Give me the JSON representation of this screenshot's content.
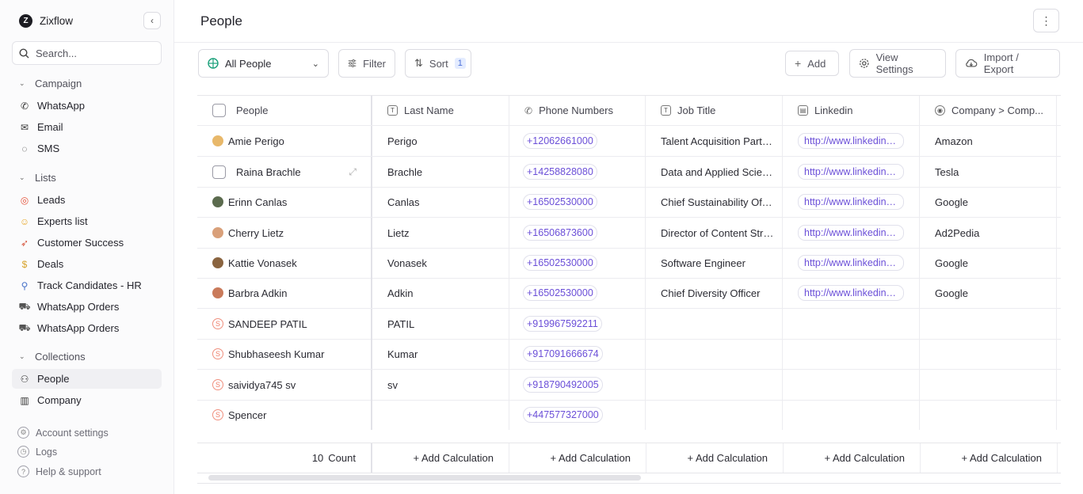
{
  "app": {
    "name": "Zixflow"
  },
  "sidebar": {
    "search_placeholder": "Search...",
    "sections": [
      {
        "title": "Campaign",
        "items": [
          {
            "label": "WhatsApp",
            "icon": "whatsapp-icon"
          },
          {
            "label": "Email",
            "icon": "email-icon"
          },
          {
            "label": "SMS",
            "icon": "sms-icon"
          }
        ]
      },
      {
        "title": "Lists",
        "items": [
          {
            "label": "Leads",
            "icon": "target-emoji-icon"
          },
          {
            "label": "Experts list",
            "icon": "nerd-emoji-icon"
          },
          {
            "label": "Customer Success",
            "icon": "rocket-emoji-icon"
          },
          {
            "label": "Deals",
            "icon": "money-bag-emoji-icon"
          },
          {
            "label": "Track Candidates - HR",
            "icon": "magnifier-emoji-icon"
          },
          {
            "label": "WhatsApp Orders",
            "icon": "cart-emoji-icon"
          },
          {
            "label": "WhatsApp Orders",
            "icon": "cart-emoji-icon"
          }
        ]
      },
      {
        "title": "Collections",
        "items": [
          {
            "label": "People",
            "icon": "people-icon",
            "active": true
          },
          {
            "label": "Company",
            "icon": "building-icon"
          }
        ]
      }
    ],
    "footer": [
      {
        "label": "Account settings",
        "icon": "gear-icon"
      },
      {
        "label": "Logs",
        "icon": "clock-icon"
      },
      {
        "label": "Help & support",
        "icon": "help-icon"
      }
    ]
  },
  "header": {
    "title": "People"
  },
  "toolbar": {
    "view": "All People",
    "filter": "Filter",
    "sort": "Sort",
    "sort_count": "1",
    "add": "Add",
    "view_settings": "View Settings",
    "import_export": "Import / Export"
  },
  "table": {
    "columns": [
      "People",
      "Last Name",
      "Phone Numbers",
      "Job Title",
      "Linkedin",
      "Company > Comp..."
    ],
    "rows": [
      {
        "name": "Amie Perigo",
        "last": "Perigo",
        "phone": "+12062661000",
        "job": "Talent Acquisition Partner",
        "linkedin": "http://www.linkedin.com/",
        "company": "Amazon",
        "avatar": "photo",
        "color": "#e8b86a"
      },
      {
        "name": "Raina Brachle",
        "last": "Brachle",
        "phone": "+14258828080",
        "job": "Data and Applied Scientist",
        "linkedin": "http://www.linkedin.com/",
        "company": "Tesla",
        "avatar": "checkbox",
        "color": ""
      },
      {
        "name": "Erinn Canlas",
        "last": "Canlas",
        "phone": "+16502530000",
        "job": "Chief Sustainability Officer",
        "linkedin": "http://www.linkedin.com/",
        "company": "Google",
        "avatar": "photo",
        "color": "#5b6b4e"
      },
      {
        "name": "Cherry Lietz",
        "last": "Lietz",
        "phone": "+16506873600",
        "job": "Director of Content Strategy",
        "linkedin": "http://www.linkedin.com/",
        "company": "Ad2Pedia",
        "avatar": "photo",
        "color": "#d9a07a"
      },
      {
        "name": "Kattie Vonasek",
        "last": "Vonasek",
        "phone": "+16502530000",
        "job": "Software Engineer",
        "linkedin": "http://www.linkedin.com/",
        "company": "Google",
        "avatar": "photo",
        "color": "#8a6440"
      },
      {
        "name": "Barbra Adkin",
        "last": "Adkin",
        "phone": "+16502530000",
        "job": "Chief Diversity Officer",
        "linkedin": "http://www.linkedin.com/",
        "company": "Google",
        "avatar": "photo",
        "color": "#c97a5a"
      },
      {
        "name": "SANDEEP PATIL",
        "last": "PATIL",
        "phone": "+919967592211",
        "job": "",
        "linkedin": "",
        "company": "",
        "avatar": "S",
        "color": "#ef7d68"
      },
      {
        "name": "Shubhaseesh Kumar",
        "last": "Kumar",
        "phone": "+917091666674",
        "job": "",
        "linkedin": "",
        "company": "",
        "avatar": "S",
        "color": "#ef7d68"
      },
      {
        "name": "saividya745 sv",
        "last": "sv",
        "phone": "+918790492005",
        "job": "",
        "linkedin": "",
        "company": "",
        "avatar": "S",
        "color": "#ef7d68"
      },
      {
        "name": "Spencer",
        "last": "",
        "phone": "+447577327000",
        "job": "",
        "linkedin": "",
        "company": "",
        "avatar": "S",
        "color": "#ef7d68"
      }
    ],
    "footer": {
      "count_value": "10",
      "count_label": "Count",
      "add_calc": "+ Add Calculation"
    }
  }
}
